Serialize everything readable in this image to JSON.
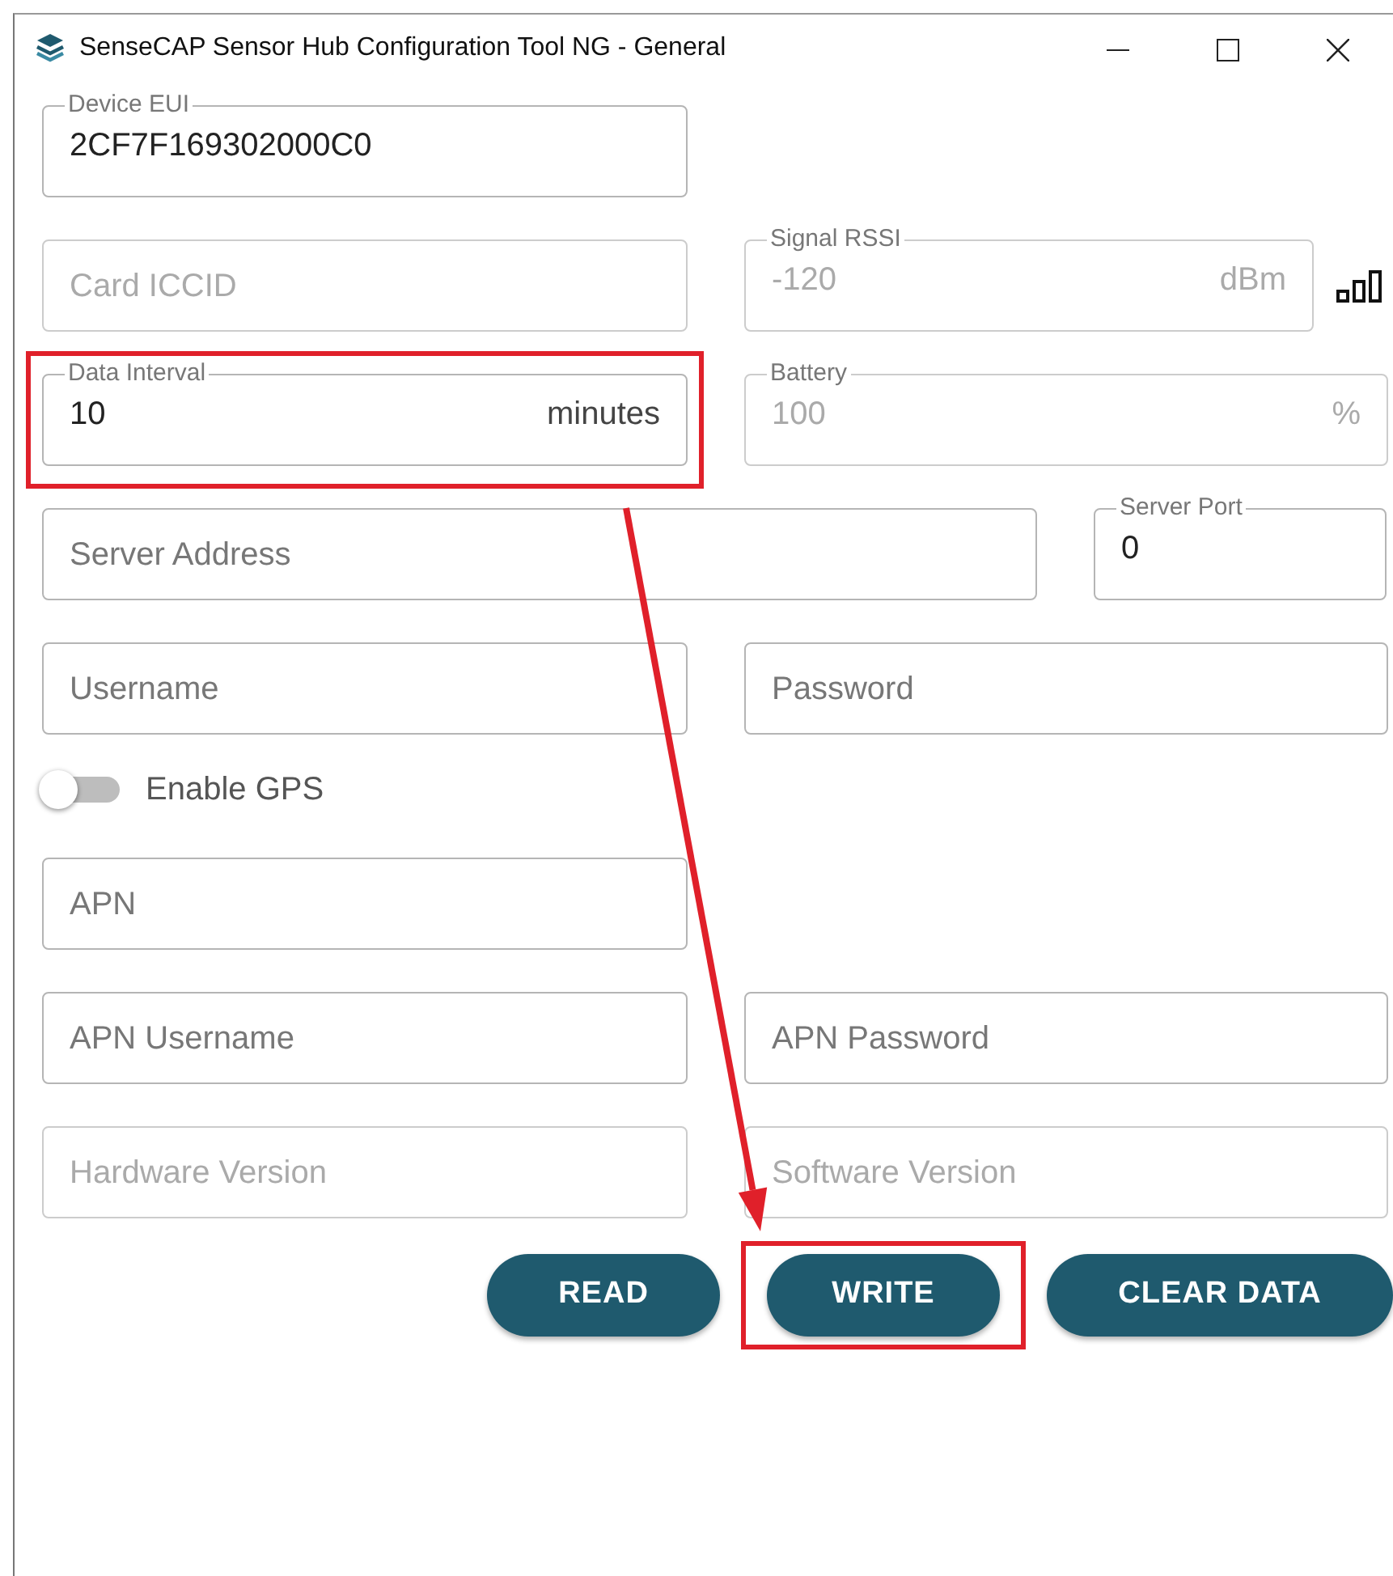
{
  "window": {
    "title": "SenseCAP Sensor Hub Configuration Tool NG - General"
  },
  "rows": [
    {
      "fields": [
        {
          "label": "Device EUI",
          "value": "2CF7F169302000C0",
          "disabled": false
        }
      ]
    },
    {
      "fields": [
        {
          "placeholder": "Card ICCID",
          "disabled": true
        },
        {
          "label": "Signal RSSI",
          "value": "-120",
          "unit": "dBm",
          "disabled": true,
          "signal_icon": true
        }
      ]
    },
    {
      "fields": [
        {
          "label": "Data Interval",
          "value": "10",
          "unit": "minutes",
          "disabled": false,
          "highlighted": true
        },
        {
          "label": "Battery",
          "value": "100",
          "unit": "%",
          "disabled": true
        }
      ]
    },
    {
      "fields": [
        {
          "placeholder": "Server Address",
          "disabled": false
        },
        {
          "label": "Server Port",
          "value": "0",
          "disabled": false
        }
      ]
    },
    {
      "fields": [
        {
          "placeholder": "Username",
          "disabled": false
        },
        {
          "placeholder": "Password",
          "disabled": false
        }
      ]
    },
    {
      "toggle": {
        "label": "Enable GPS",
        "on": false
      }
    },
    {
      "fields": [
        {
          "placeholder": "APN",
          "disabled": false
        }
      ]
    },
    {
      "fields": [
        {
          "placeholder": "APN Username",
          "disabled": false
        },
        {
          "placeholder": "APN Password",
          "disabled": false
        }
      ]
    },
    {
      "fields": [
        {
          "placeholder": "Hardware Version",
          "disabled": true
        },
        {
          "placeholder": "Software Version",
          "disabled": true
        }
      ]
    }
  ],
  "buttons": [
    {
      "label": "READ",
      "highlighted": false
    },
    {
      "label": "WRITE",
      "highlighted": true
    },
    {
      "label": "CLEAR DATA",
      "highlighted": false
    }
  ],
  "annotation_arrow": true
}
